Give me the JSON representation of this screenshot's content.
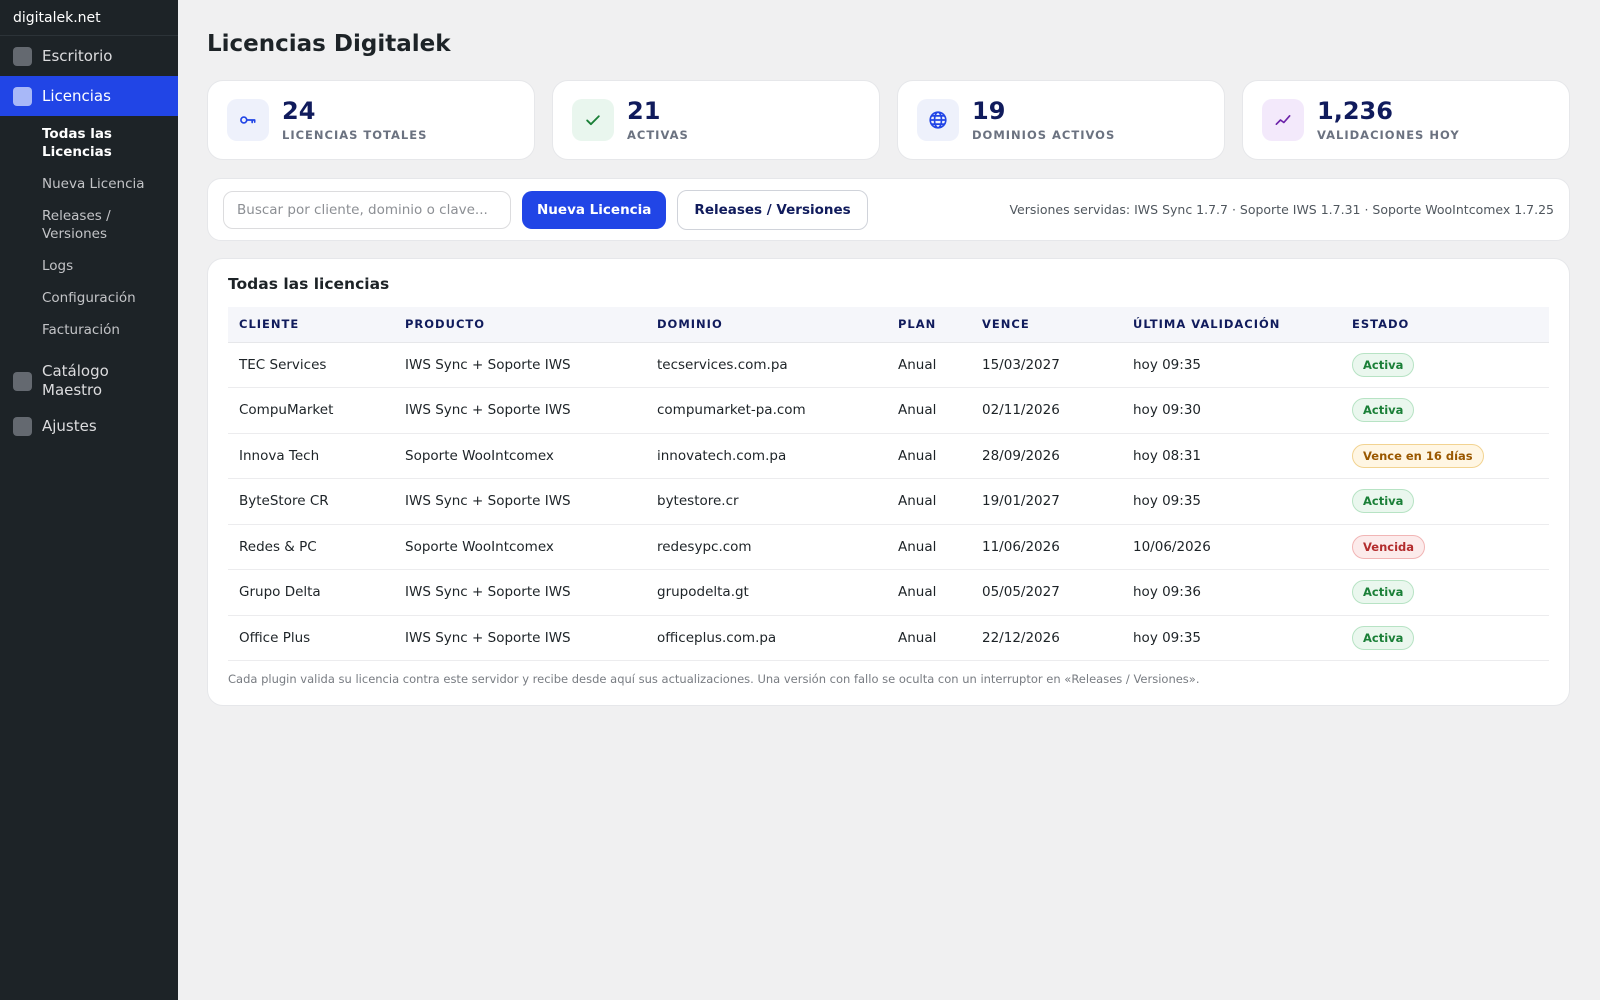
{
  "sidebar": {
    "brand": "digitalek.net",
    "items": [
      {
        "label": "Escritorio"
      },
      {
        "label": "Licencias"
      },
      {
        "label": "Catálogo Maestro"
      },
      {
        "label": "Ajustes"
      }
    ],
    "submenu": [
      {
        "label": "Todas las Licencias"
      },
      {
        "label": "Nueva Licencia"
      },
      {
        "label": "Releases / Versiones"
      },
      {
        "label": "Logs"
      },
      {
        "label": "Configuración"
      },
      {
        "label": "Facturación"
      }
    ]
  },
  "page": {
    "title": "Licencias Digitalek"
  },
  "stats": [
    {
      "value": "24",
      "label": "LICENCIAS TOTALES",
      "icon": "key-icon",
      "icon_bg": "#eef1fb",
      "icon_color": "#2145e6"
    },
    {
      "value": "21",
      "label": "ACTIVAS",
      "icon": "check-icon",
      "icon_bg": "#e9f6ee",
      "icon_color": "#1a7f37"
    },
    {
      "value": "19",
      "label": "DOMINIOS ACTIVOS",
      "icon": "globe-icon",
      "icon_bg": "#eef1fb",
      "icon_color": "#2145e6"
    },
    {
      "value": "1,236",
      "label": "VALIDACIONES HOY",
      "icon": "trend-icon",
      "icon_bg": "#f3e9fb",
      "icon_color": "#6b21a8"
    }
  ],
  "toolbar": {
    "search_placeholder": "Buscar por cliente, dominio o clave...",
    "new_label": "Nueva Licencia",
    "releases_label": "Releases / Versiones",
    "versions_info": "Versiones servidas: IWS Sync 1.7.7 · Soporte IWS 1.7.31 · Soporte WooIntcomex 1.7.25"
  },
  "table": {
    "title": "Todas las licencias",
    "headers": [
      "CLIENTE",
      "PRODUCTO",
      "DOMINIO",
      "PLAN",
      "VENCE",
      "ÚLTIMA VALIDACIÓN",
      "ESTADO"
    ],
    "rows": [
      {
        "cliente": "TEC Services",
        "producto": "IWS Sync + Soporte IWS",
        "dominio": "tecservices.com.pa",
        "plan": "Anual",
        "vence": "15/03/2027",
        "ultima": "hoy 09:35",
        "estado": "Activa",
        "estado_type": "activa"
      },
      {
        "cliente": "CompuMarket",
        "producto": "IWS Sync + Soporte IWS",
        "dominio": "compumarket-pa.com",
        "plan": "Anual",
        "vence": "02/11/2026",
        "ultima": "hoy 09:30",
        "estado": "Activa",
        "estado_type": "activa"
      },
      {
        "cliente": "Innova Tech",
        "producto": "Soporte WooIntcomex",
        "dominio": "innovatech.com.pa",
        "plan": "Anual",
        "vence": "28/09/2026",
        "ultima": "hoy 08:31",
        "estado": "Vence en 16 días",
        "estado_type": "warn"
      },
      {
        "cliente": "ByteStore CR",
        "producto": "IWS Sync + Soporte IWS",
        "dominio": "bytestore.cr",
        "plan": "Anual",
        "vence": "19/01/2027",
        "ultima": "hoy 09:35",
        "estado": "Activa",
        "estado_type": "activa"
      },
      {
        "cliente": "Redes & PC",
        "producto": "Soporte WooIntcomex",
        "dominio": "redesypc.com",
        "plan": "Anual",
        "vence": "11/06/2026",
        "ultima": "10/06/2026",
        "estado": "Vencida",
        "estado_type": "vencida"
      },
      {
        "cliente": "Grupo Delta",
        "producto": "IWS Sync + Soporte IWS",
        "dominio": "grupodelta.gt",
        "plan": "Anual",
        "vence": "05/05/2027",
        "ultima": "hoy 09:36",
        "estado": "Activa",
        "estado_type": "activa"
      },
      {
        "cliente": "Office Plus",
        "producto": "IWS Sync + Soporte IWS",
        "dominio": "officeplus.com.pa",
        "plan": "Anual",
        "vence": "22/12/2026",
        "ultima": "hoy 09:35",
        "estado": "Activa",
        "estado_type": "activa"
      }
    ],
    "footnote": "Cada plugin valida su licencia contra este servidor y recibe desde aquí sus actualizaciones. Una versión con fallo se oculta con un interruptor en «Releases / Versiones»."
  }
}
